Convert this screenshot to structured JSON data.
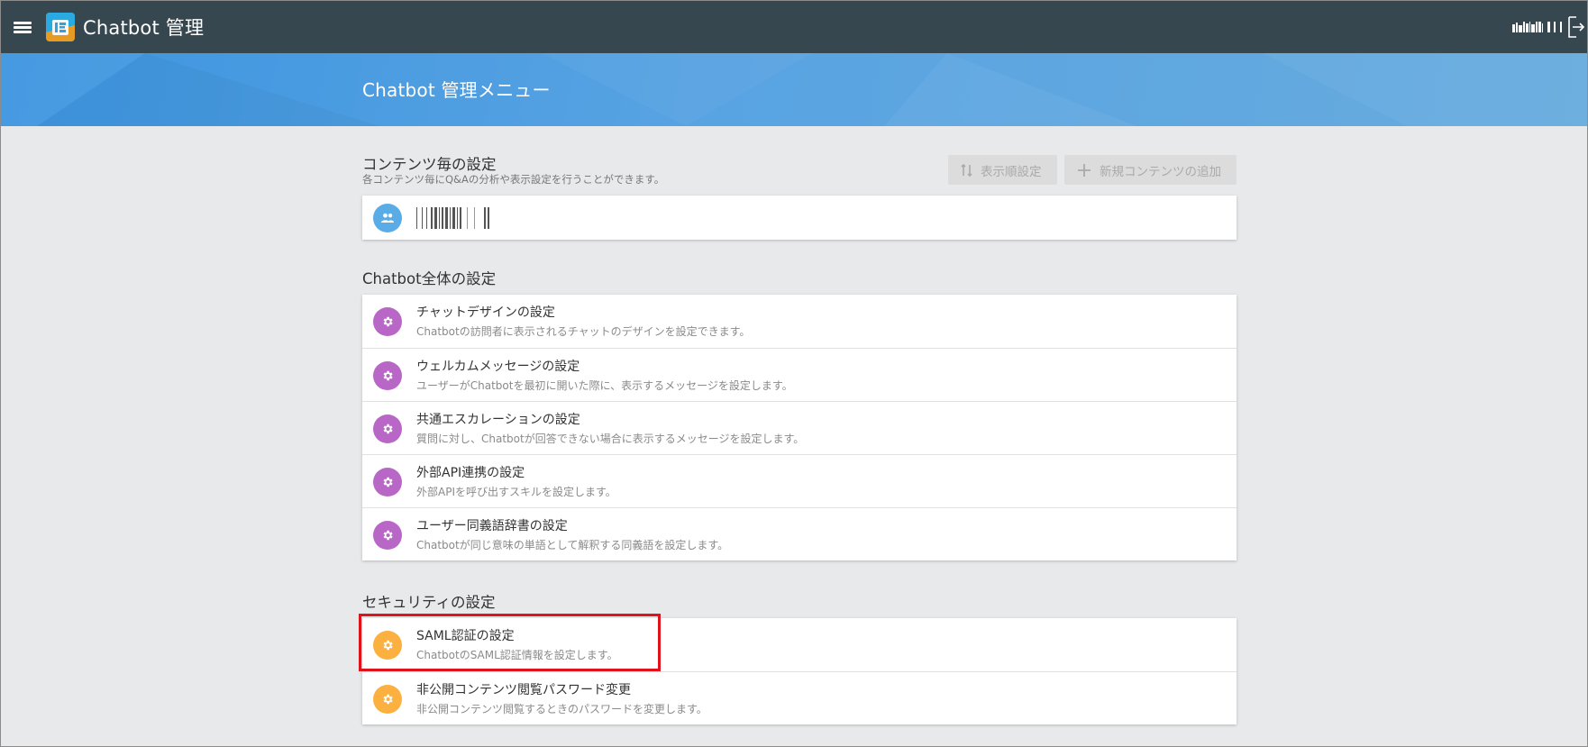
{
  "header": {
    "app_title": "Chatbot 管理",
    "menu_icon": "hamburger-menu-icon",
    "logo_icon": "app-logo-icon",
    "logout_icon": "logout-icon"
  },
  "banner": {
    "title": "Chatbot 管理メニュー"
  },
  "contents_section": {
    "title": "コンテンツ毎の設定",
    "subtitle": "各コンテンツ毎にQ&Aの分析や表示設定を行うことができます。",
    "sort_button": {
      "label": "表示順設定",
      "icon": "sort-icon"
    },
    "add_button": {
      "label": "新規コンテンツの追加",
      "icon": "plus-icon"
    },
    "items": [
      {
        "icon": "group-icon"
      }
    ]
  },
  "global_section": {
    "title": "Chatbot全体の設定",
    "items": [
      {
        "title": "チャットデザインの設定",
        "desc": "Chatbotの訪問者に表示されるチャットのデザインを設定できます。",
        "icon": "gear-icon"
      },
      {
        "title": "ウェルカムメッセージの設定",
        "desc": "ユーザーがChatbotを最初に開いた際に、表示するメッセージを設定します。",
        "icon": "gear-icon"
      },
      {
        "title": "共通エスカレーションの設定",
        "desc": "質問に対し、Chatbotが回答できない場合に表示するメッセージを設定します。",
        "icon": "gear-icon"
      },
      {
        "title": "外部API連携の設定",
        "desc": "外部APIを呼び出すスキルを設定します。",
        "icon": "gear-icon"
      },
      {
        "title": "ユーザー同義語辞書の設定",
        "desc": "Chatbotが同じ意味の単語として解釈する同義語を設定します。",
        "icon": "gear-icon"
      }
    ]
  },
  "security_section": {
    "title": "セキュリティの設定",
    "items": [
      {
        "title": "SAML認証の設定",
        "desc": "ChatbotのSAML認証情報を設定します。",
        "icon": "gear-icon"
      },
      {
        "title": "非公開コンテンツ閲覧パスワード変更",
        "desc": "非公開コンテンツ閲覧するときのパスワードを変更します。",
        "icon": "gear-icon"
      }
    ]
  },
  "colors": {
    "topbar": "#37474f",
    "banner": "#4a9ce0",
    "purple_icon": "#b967c7",
    "orange_icon": "#fbb040",
    "blue_icon": "#5aace6",
    "highlight": "#e0131c"
  }
}
